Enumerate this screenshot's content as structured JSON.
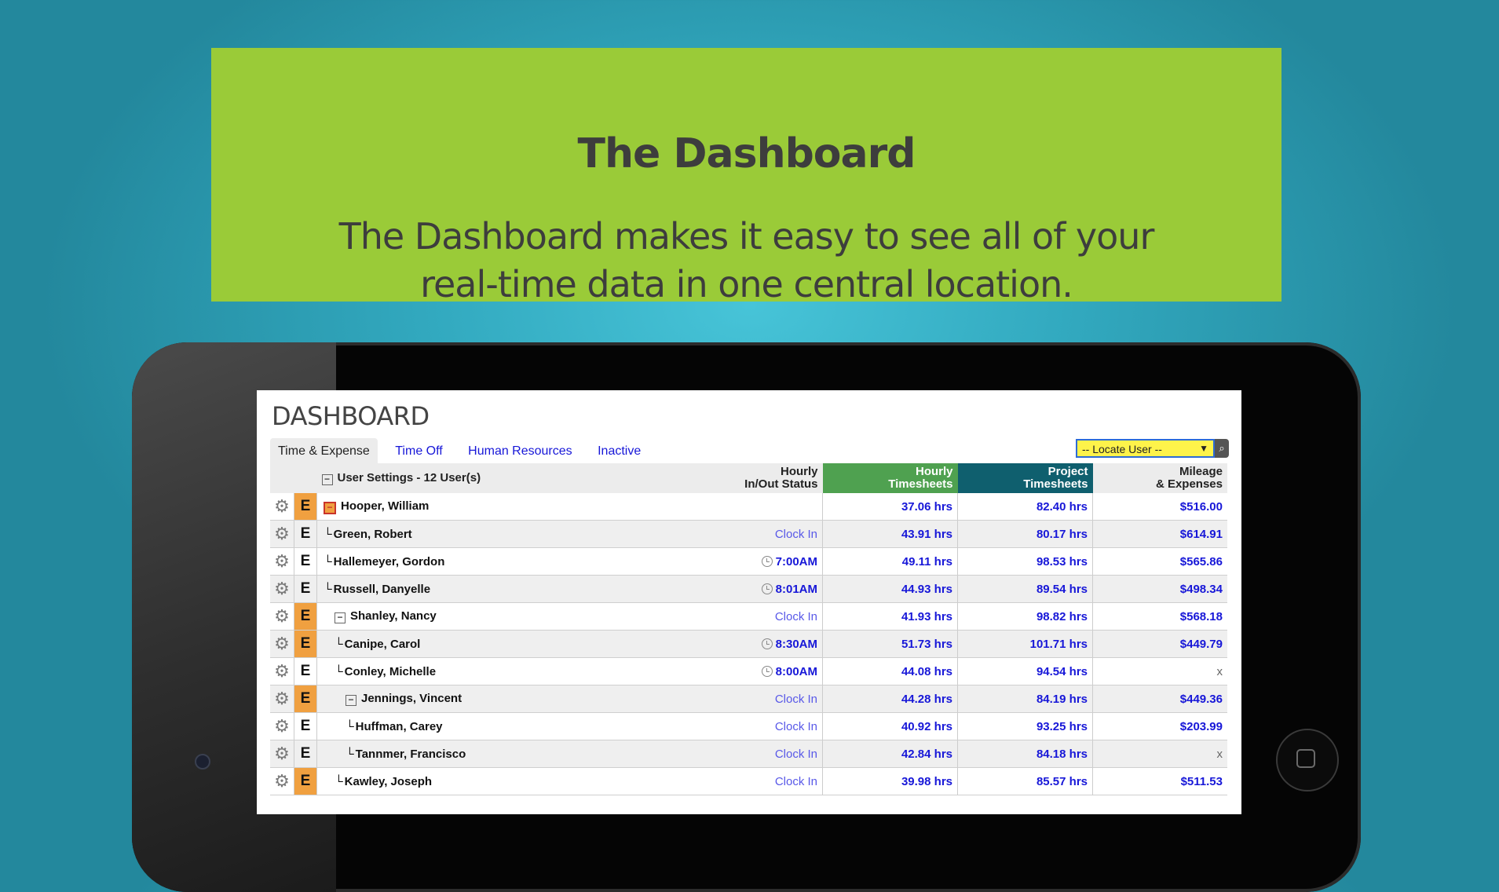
{
  "banner": {
    "title": "The Dashboard",
    "subtitle_line1": "The Dashboard makes it easy to see all of your",
    "subtitle_line2": "real-time data in one central location."
  },
  "app": {
    "page_title": "DASHBOARD",
    "tabs": [
      {
        "label": "Time & Expense",
        "active": true
      },
      {
        "label": "Time Off",
        "active": false
      },
      {
        "label": "Human Resources",
        "active": false
      },
      {
        "label": "Inactive",
        "active": false
      }
    ],
    "locate_user": {
      "placeholder": "-- Locate User --"
    },
    "columns": {
      "user_settings": "User Settings - 12 User(s)",
      "status_line1": "Hourly",
      "status_line2": "In/Out Status",
      "hourly_line1": "Hourly",
      "hourly_line2": "Timesheets",
      "project_line1": "Project",
      "project_line2": "Timesheets",
      "mileage_line1": "Mileage",
      "mileage_line2": "& Expenses"
    },
    "rows": [
      {
        "name": "Hooper, William",
        "status": "",
        "hourly": "37.06 hrs",
        "project": "82.40 hrs",
        "mileage": "$516.00"
      },
      {
        "name": "Green, Robert",
        "status": "Clock In",
        "hourly": "43.91 hrs",
        "project": "80.17 hrs",
        "mileage": "$614.91"
      },
      {
        "name": "Hallemeyer, Gordon",
        "status": "7:00AM",
        "hourly": "49.11 hrs",
        "project": "98.53 hrs",
        "mileage": "$565.86"
      },
      {
        "name": "Russell, Danyelle",
        "status": "8:01AM",
        "hourly": "44.93 hrs",
        "project": "89.54 hrs",
        "mileage": "$498.34"
      },
      {
        "name": "Shanley, Nancy",
        "status": "Clock In",
        "hourly": "41.93 hrs",
        "project": "98.82 hrs",
        "mileage": "$568.18"
      },
      {
        "name": "Canipe, Carol",
        "status": "8:30AM",
        "hourly": "51.73 hrs",
        "project": "101.71 hrs",
        "mileage": "$449.79"
      },
      {
        "name": "Conley, Michelle",
        "status": "8:00AM",
        "hourly": "44.08 hrs",
        "project": "94.54 hrs",
        "mileage": "x"
      },
      {
        "name": "Jennings, Vincent",
        "status": "Clock In",
        "hourly": "44.28 hrs",
        "project": "84.19 hrs",
        "mileage": "$449.36"
      },
      {
        "name": "Huffman, Carey",
        "status": "Clock In",
        "hourly": "40.92 hrs",
        "project": "93.25 hrs",
        "mileage": "$203.99"
      },
      {
        "name": "Tannmer, Francisco",
        "status": "Clock In",
        "hourly": "42.84 hrs",
        "project": "84.18 hrs",
        "mileage": "x"
      },
      {
        "name": "Kawley, Joseph",
        "status": "Clock In",
        "hourly": "39.98 hrs",
        "project": "85.57 hrs",
        "mileage": "$511.53"
      }
    ],
    "e_label": "E",
    "colors": {
      "banner": "#9acb38",
      "hourly_header": "#4fa150",
      "project_header": "#0f5f6e",
      "e_orange": "#f0a040",
      "link_blue": "#1717d8"
    }
  }
}
